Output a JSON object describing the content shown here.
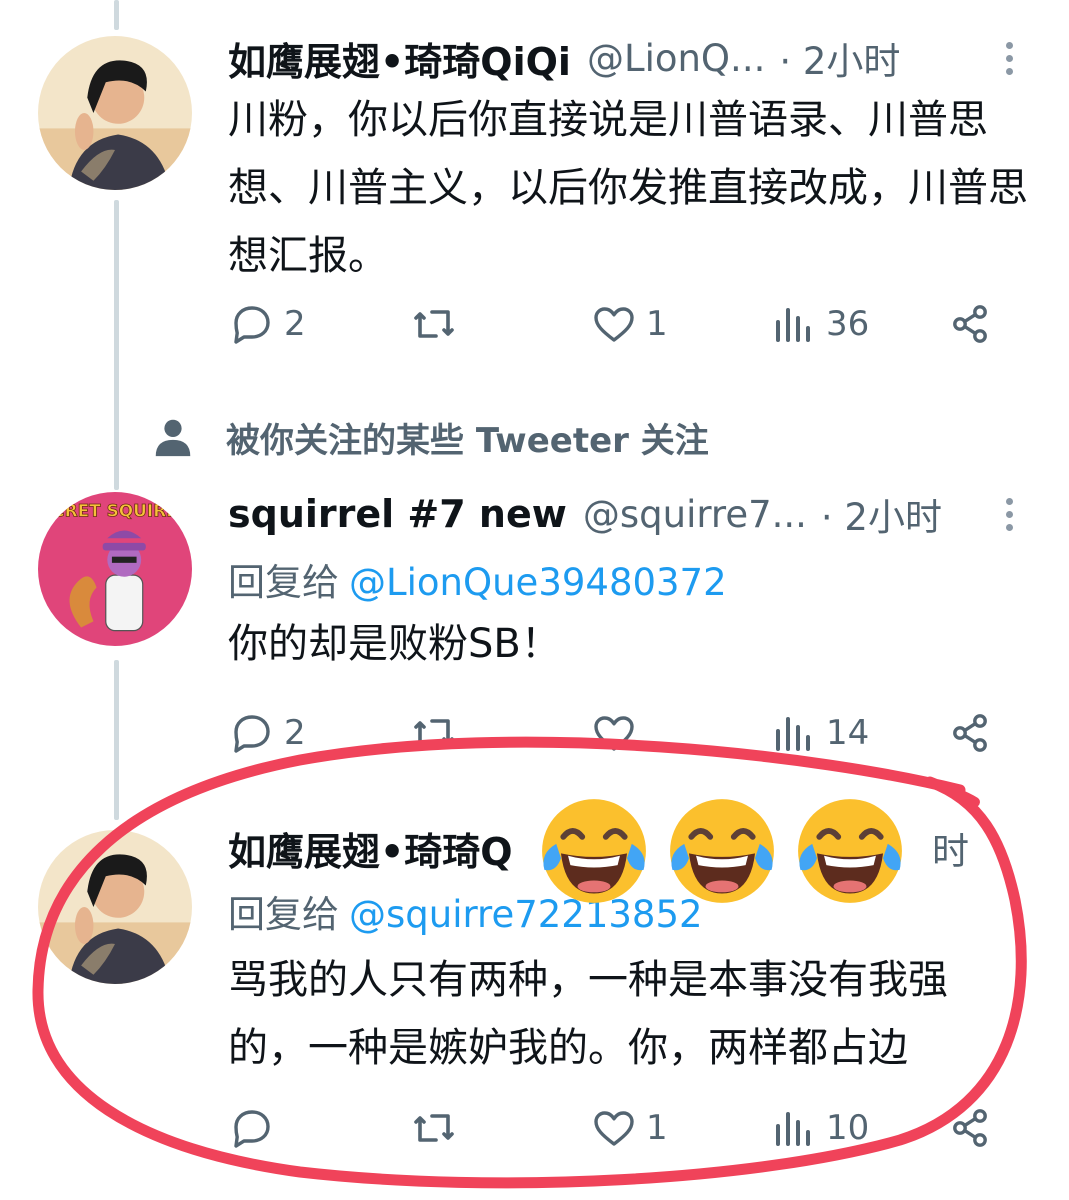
{
  "tweets": [
    {
      "name": "如鹰展翅•琦琦QiQi",
      "handle": "@LionQ...",
      "time": "· 2小时",
      "reply_prefix": "",
      "reply_mention": "",
      "text": "川粉，你以后你直接说是川普语录、川普思想、川普主义，以后你发推直接改成，川普思想汇报。",
      "reply_count": "2",
      "retweet_count": "",
      "like_count": "1",
      "view_count": "36",
      "avatar_icon": "woman-portrait"
    },
    {
      "name": "squirrel #7 new",
      "handle": "@squirre7...",
      "time": "· 2小时",
      "reply_prefix": "回复给",
      "reply_mention": "@LionQue39480372",
      "text": "你的却是败粉SB！",
      "reply_count": "2",
      "retweet_count": "",
      "like_count": "",
      "view_count": "14",
      "avatar_icon": "secret-squirrel-cartoon",
      "avatar_text": "SECRET SQUIRREL"
    },
    {
      "name": "如鹰展翅•琦琦Q",
      "handle": "",
      "time": "时",
      "reply_prefix": "回复给",
      "reply_mention": "@squirre72213852",
      "text": "骂我的人只有两种，一种是本事没有我强的，一种是嫉妒我的。你，两样都占边",
      "reply_count": "",
      "retweet_count": "",
      "like_count": "1",
      "view_count": "10",
      "avatar_icon": "woman-portrait"
    }
  ],
  "social_context": {
    "label": "被你关注的某些 Tweeter 关注",
    "icon": "person-icon"
  },
  "overlay": {
    "emojis": [
      "tears-of-joy-emoji",
      "tears-of-joy-emoji",
      "tears-of-joy-emoji"
    ],
    "annotation": "red-hand-drawn-circle"
  },
  "colors": {
    "text_primary": "#0f1419",
    "text_secondary": "#536471",
    "link": "#1d9bf0",
    "thread_line": "#cfd9de",
    "annotation_red": "#f0435a",
    "emoji_yellow": "#fbc02d"
  }
}
